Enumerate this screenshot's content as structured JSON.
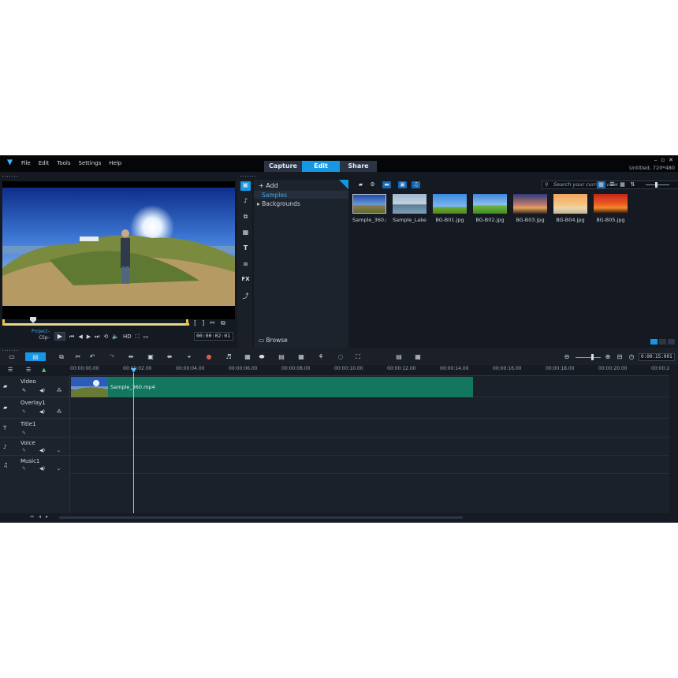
{
  "menu": [
    "File",
    "Edit",
    "Tools",
    "Settings",
    "Help"
  ],
  "mode_tabs": [
    {
      "label": "Capture",
      "active": false
    },
    {
      "label": "Edit",
      "active": true
    },
    {
      "label": "Share",
      "active": false
    }
  ],
  "window_controls": [
    "–",
    "▫",
    "✕"
  ],
  "project_info": "Untitled, 720*480",
  "preview": {
    "project_label": "Project–",
    "clip_label": "Clip–",
    "play_glyph": "▶",
    "hd_label": "HD",
    "timecode": "00:00:02:01",
    "mark_in": "[",
    "mark_out": "]"
  },
  "library": {
    "add_label": "Add",
    "tree": {
      "selected": "Samples",
      "item": "Backgrounds"
    },
    "browse_label": "Browse",
    "search_placeholder": "Search your current view",
    "thumbnails": [
      {
        "label": "Sample_360.m..."
      },
      {
        "label": "Sample_Lake..."
      },
      {
        "label": "BG-B01.jpg"
      },
      {
        "label": "BG-B02.jpg"
      },
      {
        "label": "BG-B03.jpg"
      },
      {
        "label": "BG-B04.jpg"
      },
      {
        "label": "BG-B05.jpg"
      }
    ]
  },
  "timeline": {
    "duration": "0:00:15:001",
    "ruler_labels": [
      "00:00:00.00",
      "00:00:02.00",
      "00:00:04.00",
      "00:00:06.00",
      "00:00:08.00",
      "00:00:10.00",
      "00:00:12.00",
      "00:00:14.00",
      "00:00:16.00",
      "00:00:18.00",
      "00:00:20.00",
      "00:00:2"
    ],
    "tracks": [
      {
        "name": "Video"
      },
      {
        "name": "Overlay1"
      },
      {
        "name": "Title1"
      },
      {
        "name": "Voice"
      },
      {
        "name": "Music1"
      }
    ],
    "clip_label": "Sample_360.mp4"
  },
  "colors": {
    "accent": "#1697e4",
    "clip": "#13765f",
    "background": "#1a1f28"
  }
}
